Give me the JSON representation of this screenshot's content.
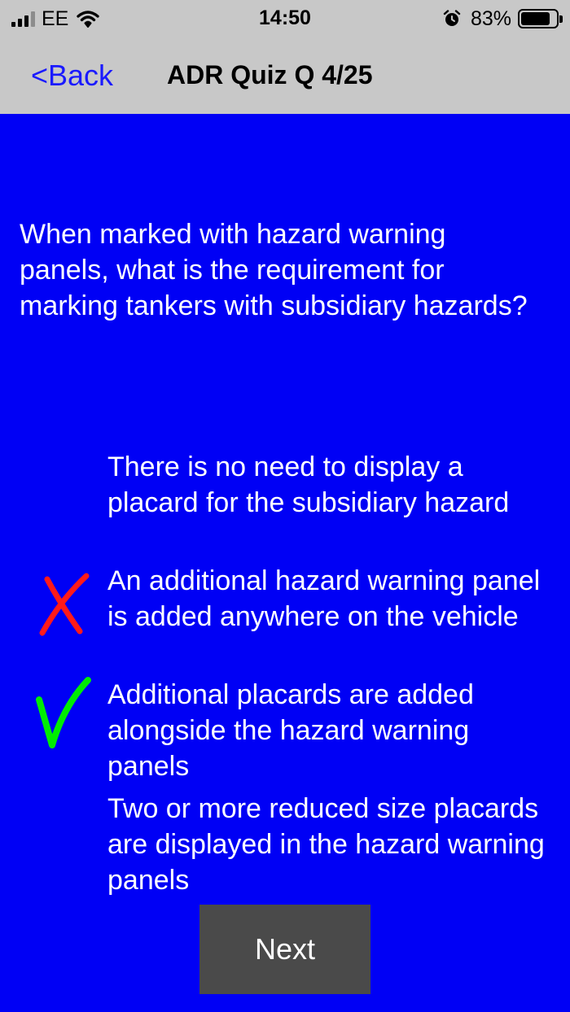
{
  "status_bar": {
    "carrier": "EE",
    "time": "14:50",
    "battery_percent": "83%",
    "battery_level": 0.83,
    "icons": [
      "signal-icon",
      "wifi-icon",
      "alarm-icon",
      "battery-icon"
    ]
  },
  "nav": {
    "back_label": "<Back",
    "title": "ADR Quiz Q 4/25"
  },
  "question": {
    "text": "When marked with hazard warning panels, what is the requirement for marking tankers with subsidiary hazards?"
  },
  "answers": [
    {
      "text": "There is no need to display a placard for the subsidiary hazard",
      "mark": "none"
    },
    {
      "text": "An additional hazard warning panel is added anywhere on the vehicle",
      "mark": "wrong",
      "mark_icon": "red-cross-icon",
      "mark_color": "#ff1a1a"
    },
    {
      "text": "Additional placards are added alongside the hazard warning panels",
      "mark": "correct",
      "mark_icon": "green-check-icon",
      "mark_color": "#00ee00"
    },
    {
      "text": "Two or more reduced size placards are displayed in the hazard warning panels",
      "mark": "none"
    }
  ],
  "next_button": {
    "label": "Next"
  },
  "colors": {
    "background": "#0000f5",
    "bar": "#c8c8c8",
    "back_link": "#1a1aff",
    "button": "#4a4a4a",
    "text": "#ffffff"
  }
}
